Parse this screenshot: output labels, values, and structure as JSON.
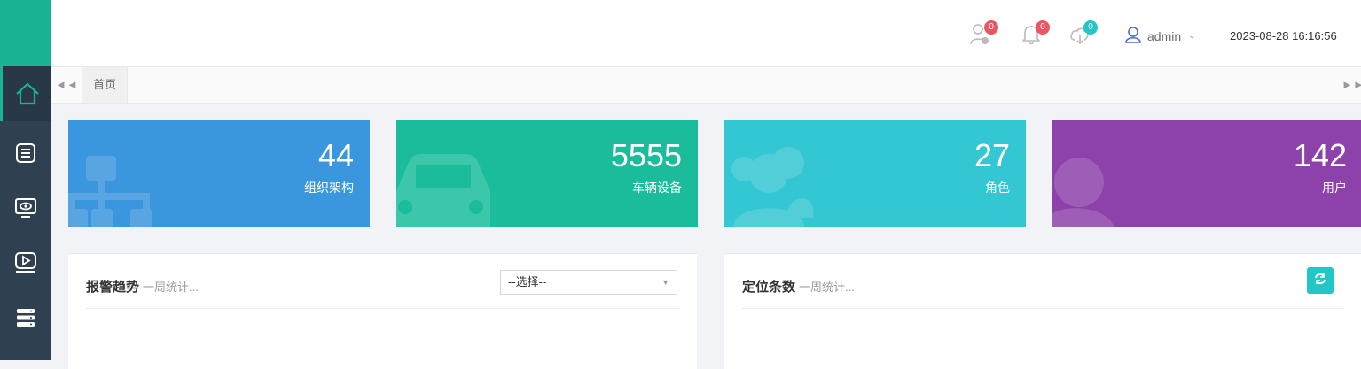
{
  "topbar": {
    "badges": {
      "alarm": "0",
      "bell": "0",
      "cloud": "0"
    },
    "user": "admin",
    "datetime": "2023-08-28 16:16:56"
  },
  "tabs": {
    "home": "首页"
  },
  "cards": [
    {
      "value": "44",
      "label": "组织架构",
      "color": "#3a96dd",
      "icon": "org-chart-icon"
    },
    {
      "value": "5555",
      "label": "车辆设备",
      "color": "#1abc9c",
      "icon": "car-icon"
    },
    {
      "value": "27",
      "label": "角色",
      "color": "#33c6d3",
      "icon": "users-group-icon"
    },
    {
      "value": "142",
      "label": "用户",
      "color": "#8d42ab",
      "icon": "user-icon"
    }
  ],
  "panels": {
    "alarm": {
      "title": "报警趋势",
      "subtitle": "一周统计...",
      "select": "--选择--"
    },
    "location": {
      "title": "定位条数",
      "subtitle": "一周统计..."
    }
  },
  "colors": {
    "sidebar": "#2f4050",
    "accent": "#1ab394",
    "badge_red": "#ed5565",
    "badge_teal": "#23c6c8"
  }
}
